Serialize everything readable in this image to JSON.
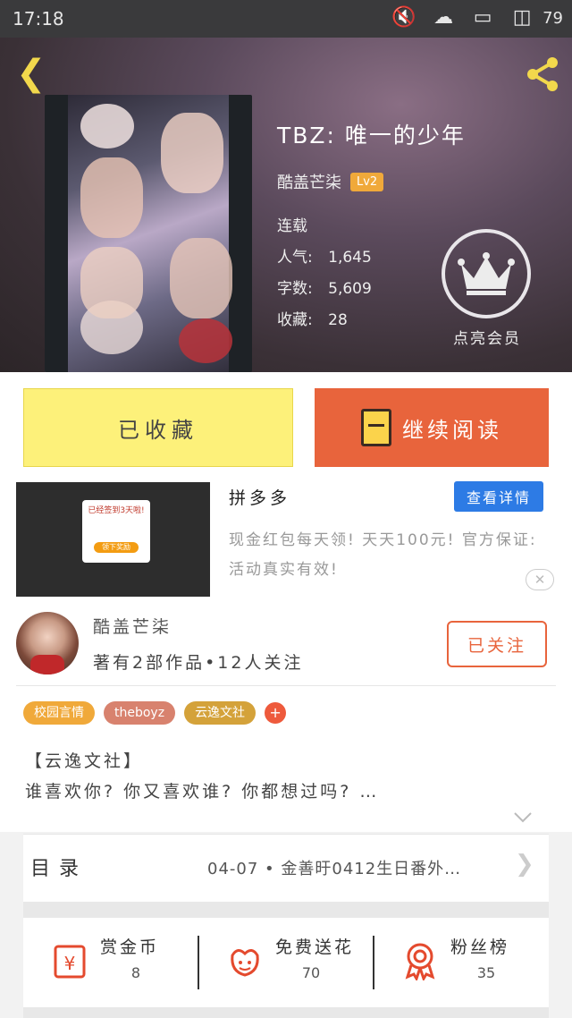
{
  "status_bar": {
    "time": "17:18",
    "battery": "79"
  },
  "book": {
    "title": "TBZ:  唯一的少年",
    "author": "酷盖芒柒",
    "level": "Lv2",
    "status": "连载",
    "popularity_label": "人气:",
    "popularity": "1,645",
    "words_label": "字数:",
    "words": "5,609",
    "favorites_label": "收藏:",
    "favorites": "28",
    "vip_label": "点亮会员"
  },
  "actions": {
    "favorite": "已收藏",
    "read": "继续阅读"
  },
  "ad": {
    "title": "拼多多",
    "button": "查看详情",
    "description": "现金红包每天领! 天天100元! 官方保证: 活动真实有效!",
    "close": "✕",
    "image_text": "已经签到3天啦!",
    "image_cta": "领下奖励"
  },
  "author_section": {
    "name": "酷盖芒柒",
    "stats": "著有2部作品•12人关注",
    "follow": "已关注"
  },
  "tags": [
    {
      "label": "校园言情",
      "color": "#f0a93a"
    },
    {
      "label": "theboyz",
      "color": "#d8826e"
    },
    {
      "label": "云逸文社",
      "color": "#d4a23a"
    }
  ],
  "tag_add": "+",
  "intro": {
    "heading": "【云逸文社】",
    "text": "谁喜欢你? 你又喜欢谁? 你都想过吗? …"
  },
  "toc": {
    "label": "目录",
    "latest": "04-07 • 金善旴0412生日番外…"
  },
  "stats": [
    {
      "icon": "coin-bag-icon",
      "label": "赏金币",
      "value": "8"
    },
    {
      "icon": "flower-icon",
      "label": "免费送花",
      "value": "70"
    },
    {
      "icon": "medal-icon",
      "label": "粉丝榜",
      "value": "35"
    }
  ],
  "colors": {
    "accent_orange": "#e8643c",
    "accent_yellow": "#fdf17a",
    "icon_gold": "#f2d84c",
    "ad_blue": "#2d7be5"
  }
}
